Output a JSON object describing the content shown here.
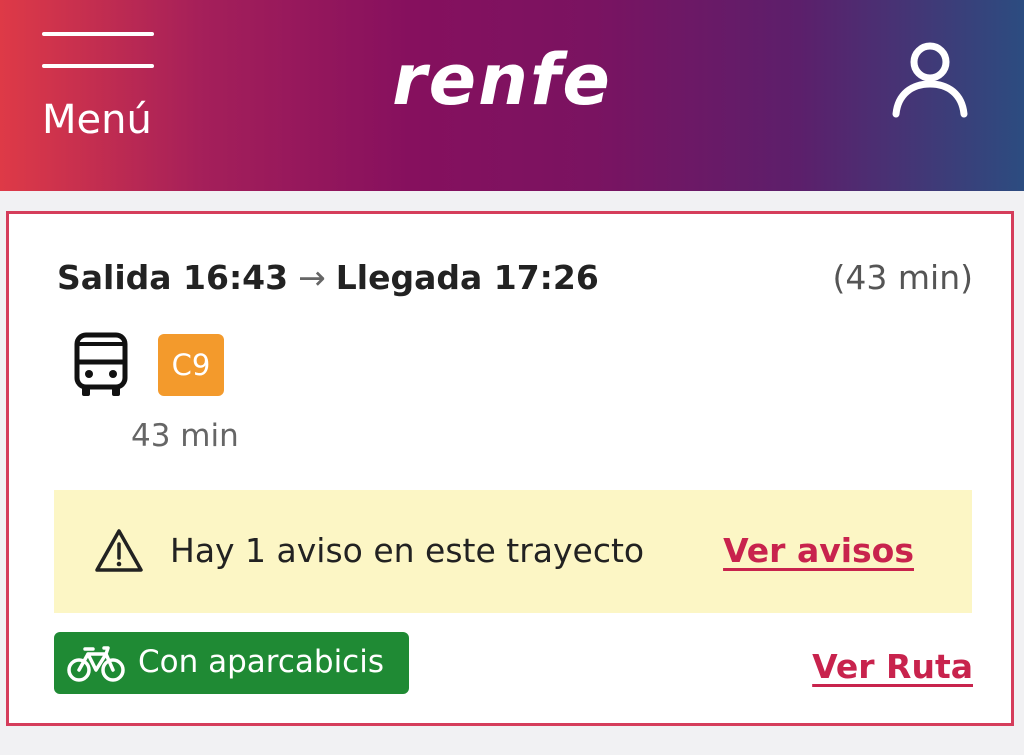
{
  "header": {
    "menu_label": "Menú",
    "logo_text": "renfe",
    "gradient_colors": [
      "#de3a47",
      "#86105e",
      "#2c4c80"
    ]
  },
  "trip": {
    "departure": "Salida 16:43",
    "arrow": "→",
    "arrival": "Llegada 17:26",
    "total_duration": "(43 min)",
    "segment": {
      "transport_icon": "bus-icon",
      "line": "C9",
      "line_color": "#f39a2c",
      "duration": "43 min"
    },
    "notice": {
      "icon": "warning-icon",
      "text": "Hay 1 aviso en este trayecto",
      "link": "Ver avisos",
      "background": "#fcf6c5"
    },
    "bike": {
      "icon": "bicycle-icon",
      "label": "Con aparcabicis",
      "color": "#1f8a34"
    },
    "route_link": "Ver Ruta",
    "accent_color": "#c8234d"
  }
}
